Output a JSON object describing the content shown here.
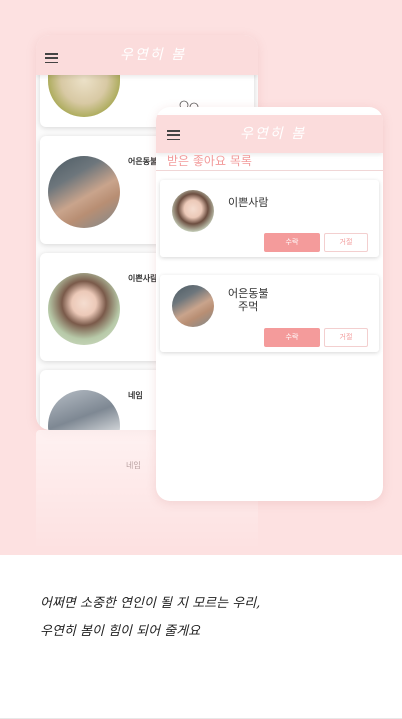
{
  "app": {
    "title": "우연히 봄"
  },
  "back_screen": {
    "cards": [
      {
        "name": "",
        "avatar": "puppy-photo"
      },
      {
        "name": "어은동불",
        "avatar": "arm-photo"
      },
      {
        "name": "이쁜사람",
        "avatar": "woman-photo"
      },
      {
        "name": "네임",
        "avatar": "hand-photo"
      }
    ],
    "reflection_name": "네임"
  },
  "front_screen": {
    "section_title": "받은 좋아요 목록",
    "likes": [
      {
        "name": "이쁜사람",
        "accept_label": "수락",
        "reject_label": "거절"
      },
      {
        "name": "어은동불\n주먹",
        "accept_label": "수락",
        "reject_label": "거절"
      }
    ]
  },
  "caption": {
    "line1": "어쩌면 소중한 연인이 될 지 모르는 우리,",
    "line2": "우연히 봄이 힘이 되어 줄게요"
  },
  "colors": {
    "background_pink": "#fde1e1",
    "appbar_pink": "#fbdcdc",
    "accent_pink": "#f49b9b",
    "title_pink": "#f29a9a"
  },
  "icons": {
    "menu": "hamburger-menu-icon"
  }
}
